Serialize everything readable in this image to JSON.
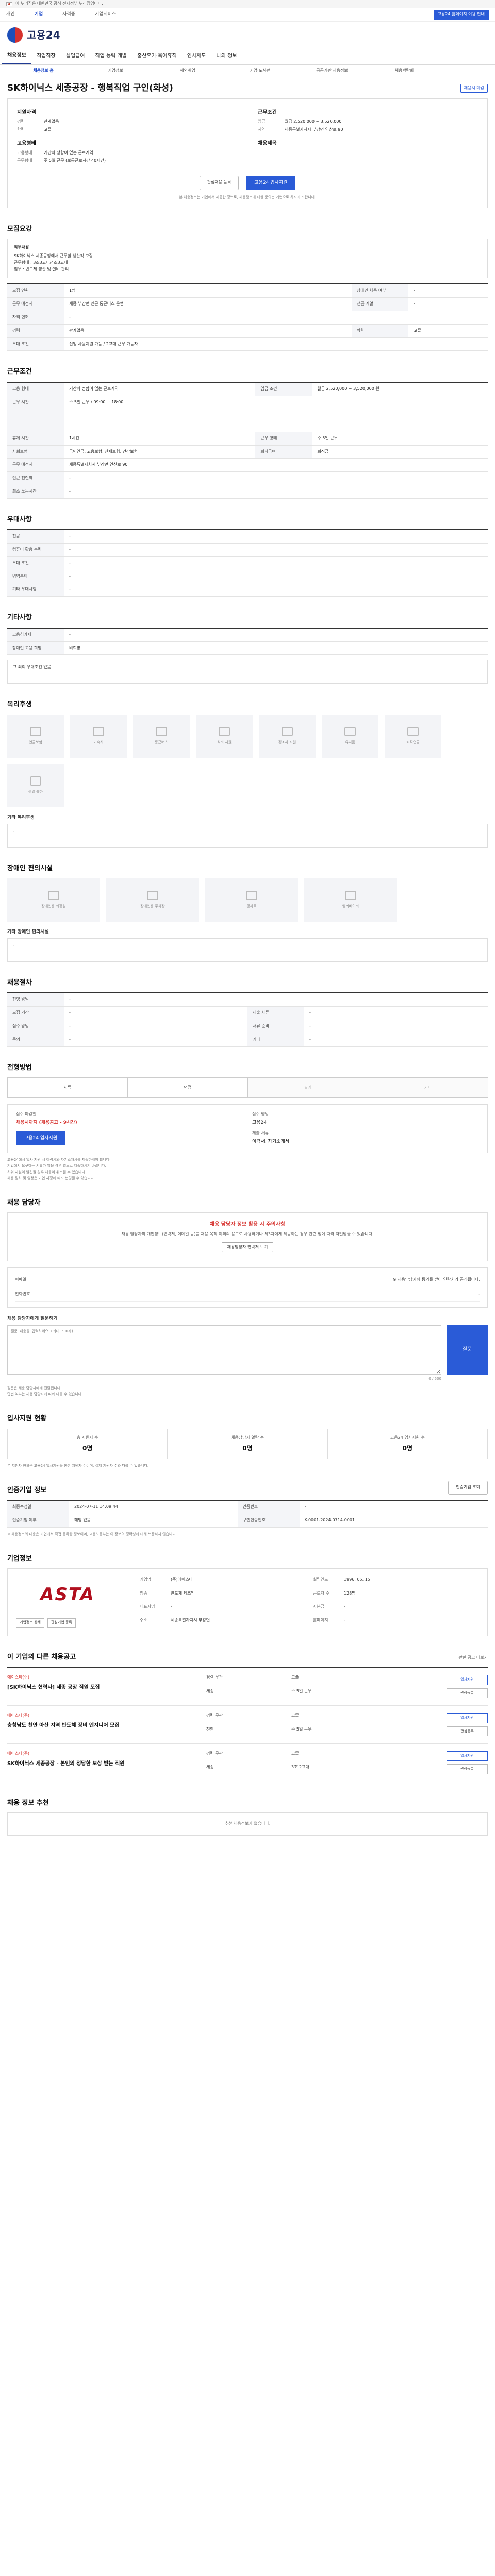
{
  "gov_bar": {
    "text": "이 누리집은 대한민국 공식 전자정부 누리집입니다."
  },
  "top_links": {
    "items": [
      "개인",
      "기업",
      "자격증",
      "기업서비스"
    ],
    "right": "고용24 홈페이지 이용 안내"
  },
  "logo": {
    "text": "고용24"
  },
  "gnb": {
    "items": [
      "채용정보",
      "직업직장",
      "실업급여",
      "직업 능력 개발",
      "출산휴가·육아휴직",
      "인사제도",
      "나의 정보"
    ]
  },
  "sub_tabs": {
    "items": [
      "채용정보 홈",
      "기업정보",
      "해외취업",
      "기업·도서관",
      "공공기관 채용정보",
      "채용박람회"
    ]
  },
  "job": {
    "title": "SK하이닉스 세종공장 - 행복직업 구인(화성)",
    "badge": "채용시 마감"
  },
  "summary": {
    "left_heading": "지원자격",
    "left_rows": [
      {
        "k": "경력",
        "v": "관계없음"
      },
      {
        "k": "학력",
        "v": "고졸"
      }
    ],
    "left_heading2": "고용형태",
    "left_rows2": [
      {
        "k": "고용형태",
        "v": "기간의 정함이 없는 근로계약"
      },
      {
        "k": "근무형태",
        "v": "주 5일 근무 (보통근로시간 40시간)"
      }
    ],
    "right_heading": "근무조건",
    "right_rows": [
      {
        "k": "임금",
        "v": "월급 2,520,000 ~ 3,520,000"
      },
      {
        "k": "지역",
        "v": "세종특별자치시 부강면 연산로 90"
      }
    ],
    "right_heading2": "채용제목",
    "btn_save": "관심채용 등록",
    "btn_apply": "고용24 입사지원",
    "notice": "본 채용정보는 기업에서 제공한 정보로, 채용정보에 대한 문의는 기업으로 하시기 바랍니다."
  },
  "recruit": {
    "title": "모집요강",
    "duty_label": "직무내용",
    "duty_text": [
      "SK하이닉스 세종공장에서 근무할 생산직 모집",
      "근무형태 : 3조3교대/4조3교대",
      "업무 : 반도체 생산 및 설비 관리"
    ],
    "rows": [
      {
        "k": "모집 인원",
        "v": "1명",
        "k2": "장애인 채용 여부",
        "v2": "-"
      },
      {
        "k": "근무 예정지",
        "v": "세종 부강면 인근 통근버스 운행",
        "k2": "전공 계열",
        "v2": "-"
      },
      {
        "k": "자격 면허",
        "v": "-",
        "k2": "",
        "v2": ""
      },
      {
        "k": "경력",
        "v": "관계없음",
        "k2": "학력",
        "v2": "고졸"
      },
      {
        "k": "우대 조건",
        "v": "신입 사원지원 가능 / 2교대 근무 가능자",
        "k2": "",
        "v2": ""
      }
    ]
  },
  "conditions": {
    "title": "근무조건",
    "rows": [
      {
        "k": "고용 형태",
        "v": "기간의 정함이 없는 근로계약",
        "k2": "임금 조건",
        "v2": "월급 2,520,000 ~ 3,520,000 원"
      },
      {
        "k": "근무 시간",
        "v": "주 5일 근무 / 09:00 ~ 18:00",
        "k2": "",
        "v2": ""
      },
      {
        "k": "휴게 시간",
        "v": "1시간",
        "k2": "근무 형태",
        "v2": "주 5일 근무"
      },
      {
        "k": "사회보험",
        "v": "국민연금, 고용보험, 산재보험, 건강보험",
        "k2": "퇴직급여",
        "v2": "퇴직금"
      },
      {
        "k": "근무 예정지",
        "v": "세종특별자치시 부강면 연산로 90",
        "k2": "",
        "v2": ""
      },
      {
        "k": "인근 전철역",
        "v": "-",
        "k2": "",
        "v2": ""
      },
      {
        "k": "최소 노동시간",
        "v": "-",
        "k2": "",
        "v2": ""
      }
    ]
  },
  "qualification": {
    "title": "우대사항",
    "rows": [
      {
        "k": "전공",
        "v": "-"
      },
      {
        "k": "컴퓨터 활용 능력",
        "v": "-"
      },
      {
        "k": "우대 조건",
        "v": "-"
      },
      {
        "k": "병역특례",
        "v": "-"
      },
      {
        "k": "기타 우대사항",
        "v": "-"
      }
    ]
  },
  "other": {
    "title": "기타사항",
    "rows": [
      {
        "k": "고용허가제",
        "v": "-"
      },
      {
        "k": "장애인 고용 희망",
        "v": "비희망"
      }
    ],
    "extra": "그 외의 우대조건 없음"
  },
  "welfare": {
    "title": "복리후생",
    "cards": [
      "연금보험",
      "기숙사",
      "통근버스",
      "식비 지원",
      "경조사 지원",
      "유니폼",
      "퇴직연금",
      "생일 축하"
    ],
    "sub": "기타 복리후생",
    "sub_text": "-"
  },
  "disability": {
    "title": "장애인 편의시설",
    "cards": [
      "장애인용 화장실",
      "장애인용 주차장",
      "경사로",
      "엘리베이터"
    ],
    "sub": "기타 장애인 편의시설",
    "sub_text": "-"
  },
  "selection": {
    "title": "채용절차",
    "rows": [
      {
        "k": "전형 방법",
        "v": "-",
        "k2": "",
        "v2": ""
      },
      {
        "k": "모집 기간",
        "v": "-",
        "k2": "제출 서류",
        "v2": "-"
      },
      {
        "k": "접수 방법",
        "v": "-",
        "k2": "서류 준비",
        "v2": "-"
      },
      {
        "k": "문의",
        "v": "-",
        "k2": "기타",
        "v2": "-"
      }
    ]
  },
  "apply": {
    "title": "전형방법",
    "methods": [
      "서류",
      "면접",
      "필기",
      "기타"
    ],
    "deadline_label": "접수 마감일",
    "deadline": "채용시까지 (채용공고 - 9시간)",
    "method_label": "접수 방법",
    "method_value": "고용24",
    "btn": "고용24 입사지원",
    "submit_label": "제출 서류",
    "submit_value": "이력서, 자기소개서",
    "bullets": [
      "고용24에서 입사 지원 시 이력서와 자기소개서를 제출하셔야 합니다.",
      "기업에서 요구하는 서류가 있을 경우 별도로 제출하시기 바랍니다.",
      "허위 사실이 발견될 경우 채용이 취소될 수 있습니다.",
      "채용 절차 및 일정은 기업 사정에 따라 변경될 수 있습니다."
    ]
  },
  "manager": {
    "title": "채용 담당자",
    "warn_title": "채용 담당자 정보 활용 시 주의사항",
    "warn_text": "채용 담당자의 개인정보(연락처, 이메일 등)를 채용 목적 이외의 용도로 사용하거나 제3자에게 제공하는 경우 관련 법에 따라 처벌받을 수 있습니다.",
    "warn_btn": "채용담당자 연락처 보기",
    "contact_rows": [
      {
        "k": "이메일",
        "v": "※ 채용담당자의 동의를 받아 연락처가 공개됩니다."
      },
      {
        "k": "전화번호",
        "v": "-"
      }
    ],
    "q_label": "채용 담당자에게 질문하기",
    "q_placeholder": "질문 내용을 입력하세요 (최대 500자)",
    "q_btn": "질문",
    "q_count": "0 / 500",
    "notes": [
      "질문은 채용 담당자에게 전달됩니다.",
      "답변 여부는 채용 담당자에 따라 다를 수 있습니다."
    ]
  },
  "stats": {
    "title": "입사지원 현황",
    "items": [
      {
        "k": "총 지원자 수",
        "v": "0명"
      },
      {
        "k": "채용담당자 열람 수",
        "v": "0명"
      },
      {
        "k": "고용24 입사지원 수",
        "v": "0명"
      }
    ],
    "note": "본 지원자 현황은 고용24 입사지원을 통한 지원자 수이며, 실제 지원자 수와 다를 수 있습니다."
  },
  "info": {
    "title": "인증기업 정보",
    "btn": "인증기업 조회",
    "rows": [
      {
        "k": "최종수정일",
        "v": "2024-07-11 14:09:44",
        "k2": "인증번호",
        "v2": "-"
      },
      {
        "k": "인증기업 여부",
        "v": "해당 없음",
        "k2": "구인인증번호",
        "v2": "K-0001-2024-0714-0001"
      }
    ],
    "note": "※ 채용정보의 내용은 기업에서 직접 등록한 정보이며, 고용노동부는 이 정보의 정확성에 대해 보증하지 않습니다."
  },
  "company": {
    "title": "기업정보",
    "logo_text": "ASTA",
    "btn_a": "기업정보 상세",
    "btn_b": "관심기업 등록",
    "rows": [
      {
        "k": "기업명",
        "v": "(주)에이스타"
      },
      {
        "k": "설립연도",
        "v": "1996. 05. 15"
      },
      {
        "k": "업종",
        "v": "반도체 제조업"
      },
      {
        "k": "근로자 수",
        "v": "128명"
      },
      {
        "k": "대표자명",
        "v": "-"
      },
      {
        "k": "자본금",
        "v": "-"
      },
      {
        "k": "주소",
        "v": "세종특별자치시 부강면"
      },
      {
        "k": "홈페이지",
        "v": "-"
      }
    ]
  },
  "related": {
    "title": "이 기업의 다른 채용공고",
    "more": "관련 공고 더보기",
    "items": [
      {
        "co": "에이스타(주)",
        "title": "[SK하이닉스 협력사] 세종 공장 직원 모집",
        "a": "경력 무관",
        "b": "고졸",
        "c": "세종",
        "d": "주 5일 근무",
        "btn1": "입사지원",
        "btn2": "관심등록"
      },
      {
        "co": "에이스타(주)",
        "title": "충청남도 천안 아산 지역 반도체 장비 엔지니어 모집",
        "a": "경력 무관",
        "b": "고졸",
        "c": "천안",
        "d": "주 5일 근무",
        "btn1": "입사지원",
        "btn2": "관심등록"
      },
      {
        "co": "에이스타(주)",
        "title": "SK하이닉스 세종공장 - 본인의 정당한 보상 받는 직원",
        "a": "경력 무관",
        "b": "고졸",
        "c": "세종",
        "d": "3조 2교대",
        "btn1": "입사지원",
        "btn2": "관심등록"
      }
    ]
  },
  "recommend": {
    "title": "채용 정보 추천",
    "text": "추천 채용정보가 없습니다."
  }
}
